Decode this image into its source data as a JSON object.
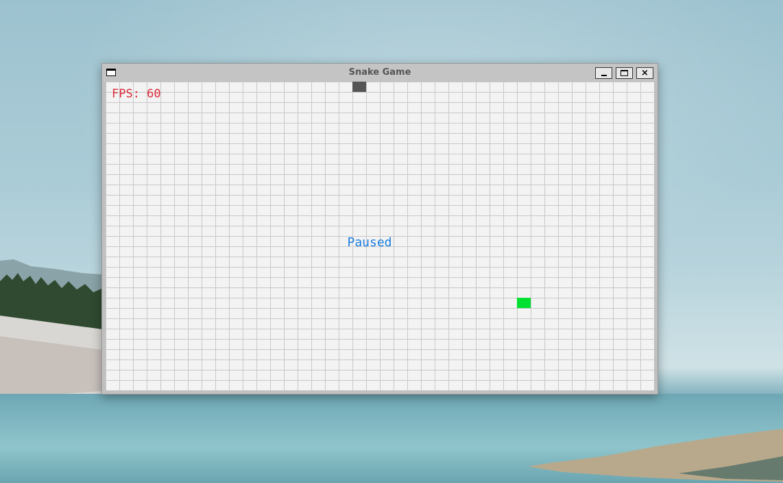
{
  "window": {
    "title": "Snake Game",
    "buttons": {
      "minimize": "minimize-icon",
      "maximize": "maximize-icon",
      "close": "×"
    }
  },
  "game": {
    "fps_text": "FPS: 60",
    "status_text": "Paused",
    "colors": {
      "fps": "#dd2a3a",
      "status": "#1a7de0",
      "snake": "#555555",
      "food": "#00e031",
      "board": "#f3f3f3",
      "grid": "#c8c8c8"
    }
  }
}
